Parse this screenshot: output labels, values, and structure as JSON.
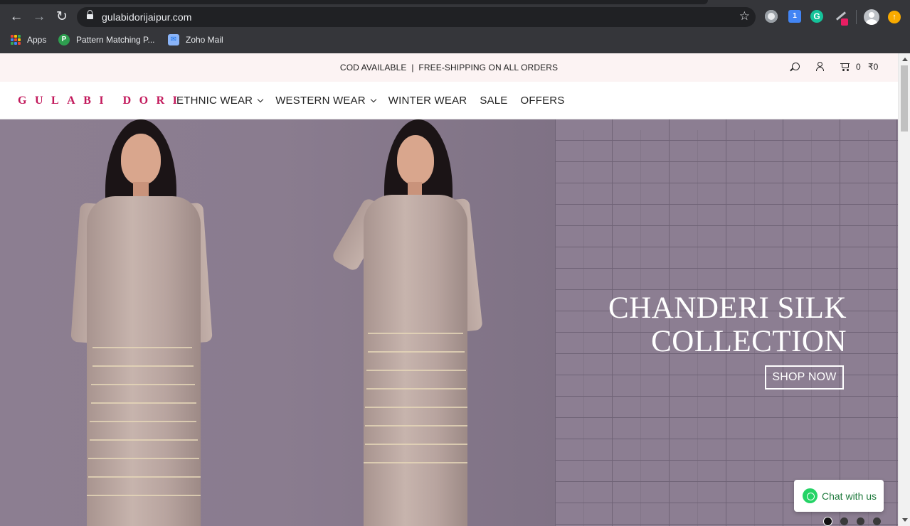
{
  "browser": {
    "url": "gulabidorijaipur.com",
    "bookmarks": [
      {
        "label": "Apps",
        "icon": "apps-grid-icon"
      },
      {
        "label": "Pattern Matching P...",
        "icon": "p-favicon-icon"
      },
      {
        "label": "Zoho Mail",
        "icon": "zoho-mail-icon"
      }
    ],
    "extension_2_label": "1",
    "extension_3_label": "G"
  },
  "announcement": {
    "text": "COD AVAILABLE  |  FREE-SHIPPING ON ALL ORDERS"
  },
  "utility": {
    "cart_count": "0",
    "cart_total": "₹0"
  },
  "header": {
    "logo": "GULABI DORI",
    "menu": [
      {
        "label": "ETHNIC WEAR",
        "dropdown": true
      },
      {
        "label": "WESTERN WEAR",
        "dropdown": true
      },
      {
        "label": "WINTER WEAR",
        "dropdown": false
      },
      {
        "label": "SALE",
        "dropdown": false
      },
      {
        "label": "OFFERS",
        "dropdown": false
      }
    ]
  },
  "hero": {
    "title_line1": "CHANDERI SILK",
    "title_line2": "COLLECTION",
    "cta": "SHOP NOW",
    "slides": 4,
    "active_slide": 1
  },
  "chat": {
    "label": "Chat with us"
  },
  "colors": {
    "brand": "#c2185b",
    "announcement_bg": "#fcf3f3",
    "hero_bg": "#8a7b8f",
    "whatsapp": "#25d366"
  }
}
